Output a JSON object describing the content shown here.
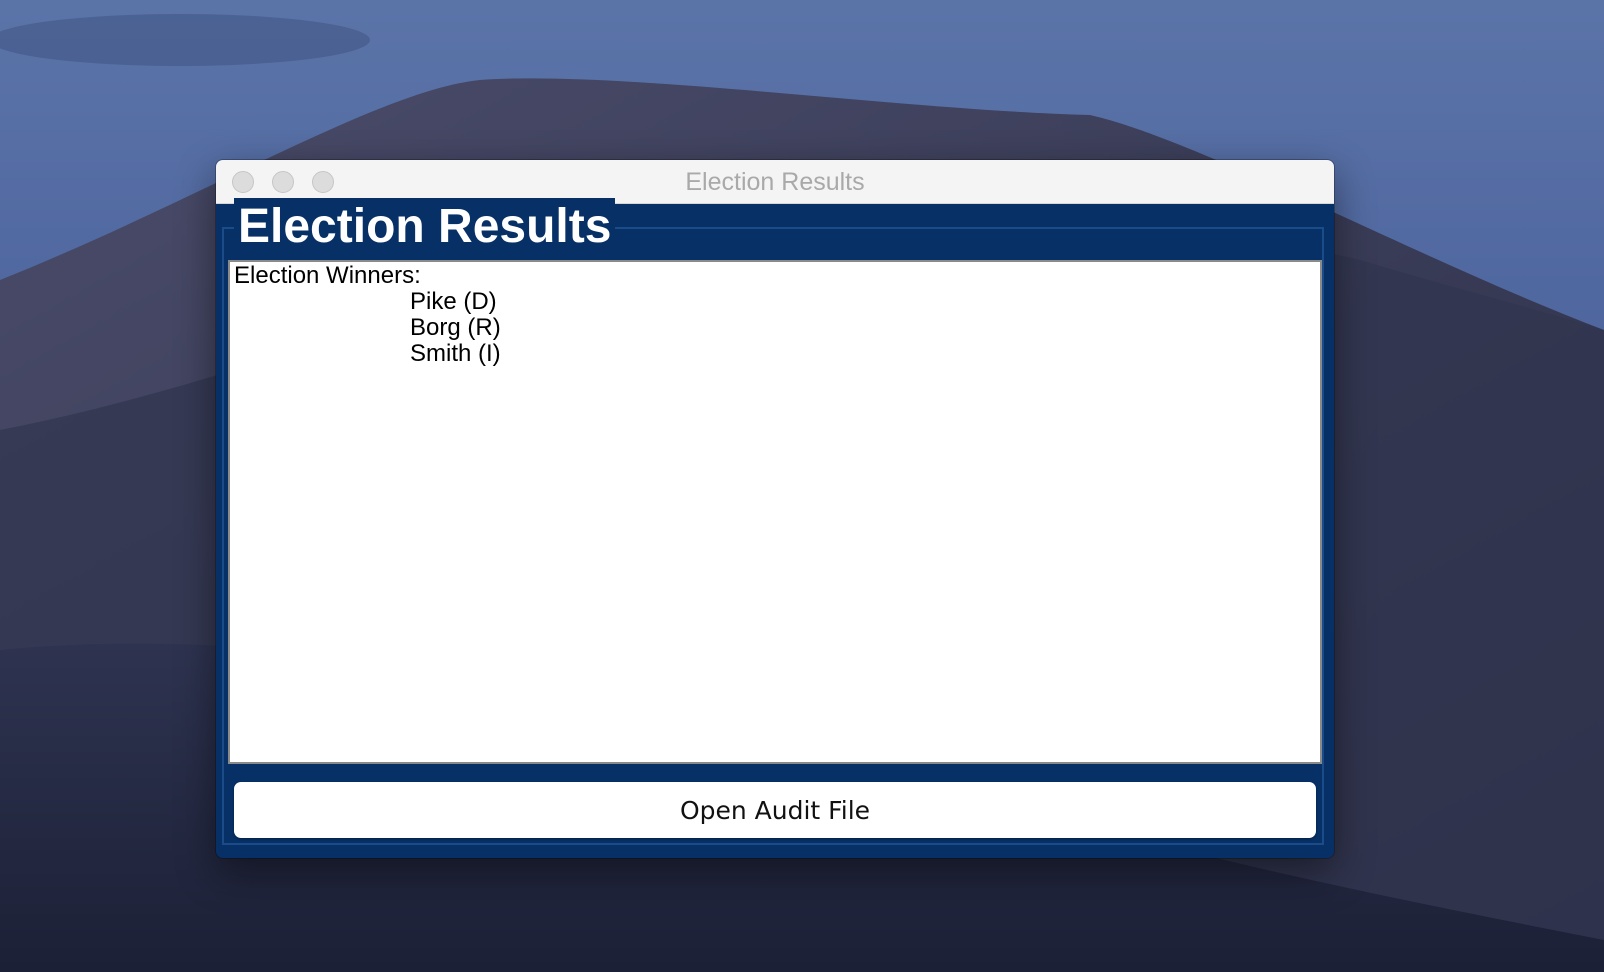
{
  "window": {
    "title": "Election Results",
    "heading": "Election Results"
  },
  "results": {
    "label": "Election Winners:",
    "winners": [
      "Pike (D)",
      "Borg (R)",
      "Smith (I)"
    ]
  },
  "actions": {
    "open_audit_label": "Open Audit File"
  },
  "colors": {
    "panel_background": "#063066",
    "heading_text": "#ffffff",
    "title_text": "#a9a9a9"
  }
}
